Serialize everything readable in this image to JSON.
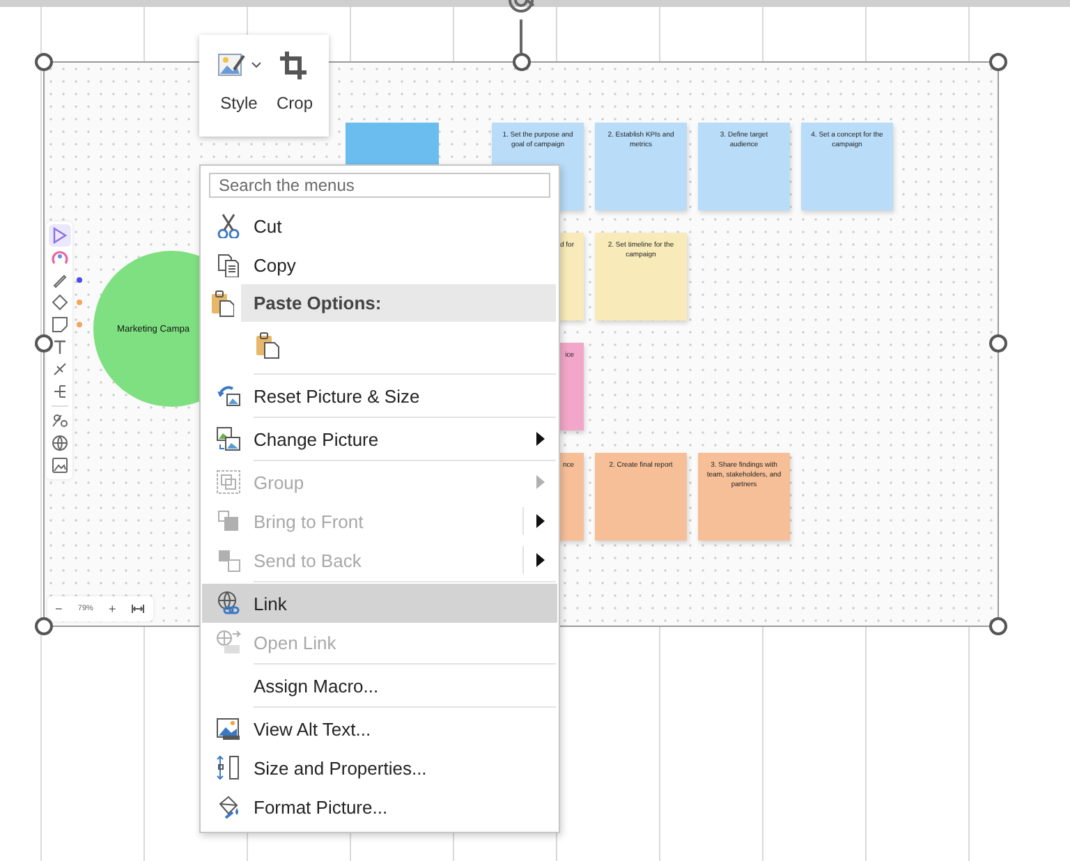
{
  "picture_toolbar": {
    "buttons": [
      {
        "label": "Style",
        "has_menu": true
      },
      {
        "label": "Crop",
        "has_menu": false
      }
    ]
  },
  "whiteboard": {
    "tools": [
      {
        "selected": true
      },
      {
        "selected": false
      },
      {
        "selected": false,
        "color": "#4b4bf0"
      },
      {
        "selected": false,
        "color": "#f5a55c"
      },
      {
        "selected": false,
        "color": "#f5a55c"
      },
      {
        "selected": false
      },
      {
        "selected": false
      },
      {
        "selected": false
      },
      {
        "selected": false
      },
      {
        "selected": false
      },
      {
        "selected": false
      }
    ],
    "shape": {
      "label": "Marketing Campa"
    },
    "note_rows": [
      [
        {
          "color": "#b9dcf8",
          "text": "1. Set the purpose and goal of campaign"
        },
        {
          "color": "#b9dcf8",
          "text": "2.  Establish KPIs and metrics"
        },
        {
          "color": "#b9dcf8",
          "text": "3. Define target audience"
        },
        {
          "color": "#b9dcf8",
          "text": "4. Set a concept for the campaign"
        }
      ],
      [
        {
          "color": "#f8ebb9",
          "text": "d for",
          "hidden_start": true
        },
        {
          "color": "#f8ebb9",
          "text": "2. Set timeline for the campaign"
        }
      ],
      [
        {
          "color": "#f2a6c9",
          "text": "ice",
          "hidden_start": true
        }
      ],
      [
        {
          "color": "#f6bf97",
          "text": "nce",
          "hidden_start": true
        },
        {
          "color": "#f6bf97",
          "text": "2. Create final report"
        },
        {
          "color": "#f6bf97",
          "text": "3. Share findings with team, stakeholders, and partners"
        }
      ]
    ],
    "zoom": {
      "minus": "−",
      "reading": "79%",
      "plus": "+"
    }
  },
  "context_menu": {
    "search": {
      "placeholder": "Search the menus"
    },
    "items": [
      {
        "kind": "command",
        "label": "Cut",
        "disabled": false,
        "selected": false
      },
      {
        "kind": "command",
        "label": "Copy",
        "disabled": false,
        "selected": false
      },
      {
        "kind": "header",
        "label": "Paste Options:"
      },
      {
        "kind": "paste_option"
      },
      {
        "kind": "separator"
      },
      {
        "kind": "command",
        "label": "Reset Picture & Size",
        "disabled": false,
        "selected": false
      },
      {
        "kind": "separator"
      },
      {
        "kind": "command",
        "label": "Change Picture",
        "disabled": false,
        "selected": false,
        "submenu": true,
        "split": false
      },
      {
        "kind": "separator"
      },
      {
        "kind": "command",
        "label": "Group",
        "disabled": true,
        "selected": false,
        "submenu": true,
        "split": false
      },
      {
        "kind": "command",
        "label": "Bring to Front",
        "disabled": true,
        "selected": false,
        "submenu": true,
        "split": true
      },
      {
        "kind": "command",
        "label": "Send to Back",
        "disabled": true,
        "selected": false,
        "submenu": true,
        "split": true
      },
      {
        "kind": "separator"
      },
      {
        "kind": "command",
        "label": "Link",
        "disabled": false,
        "selected": true
      },
      {
        "kind": "command",
        "label": "Open Link",
        "disabled": true,
        "selected": false
      },
      {
        "kind": "separator"
      },
      {
        "kind": "command",
        "label": "Assign Macro...",
        "disabled": false,
        "selected": false
      },
      {
        "kind": "separator"
      },
      {
        "kind": "command",
        "label": "View Alt Text...",
        "disabled": false,
        "selected": false
      },
      {
        "kind": "command",
        "label": "Size and Properties...",
        "disabled": false,
        "selected": false
      },
      {
        "kind": "command",
        "label": "Format Picture...",
        "disabled": false,
        "selected": false
      }
    ]
  }
}
